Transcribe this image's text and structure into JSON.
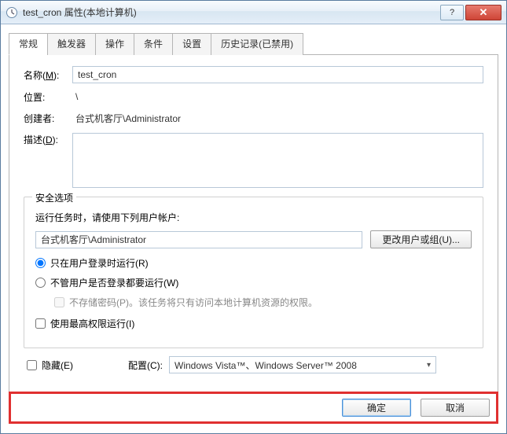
{
  "window": {
    "title": "test_cron 属性(本地计算机)",
    "close_glyph": "✕",
    "help_glyph": "?"
  },
  "tabs": {
    "general": "常规",
    "triggers": "触发器",
    "actions": "操作",
    "conditions": "条件",
    "settings": "设置",
    "history": "历史记录(已禁用)"
  },
  "general": {
    "name_label": "名称(",
    "name_key": "M",
    "name_label_end": "):",
    "name_value": "test_cron",
    "location_label": "位置:",
    "location_value": "\\",
    "creator_label": "创建者:",
    "creator_value": "台式机客厅\\Administrator",
    "desc_label": "描述(",
    "desc_key": "D",
    "desc_label_end": "):",
    "desc_value": ""
  },
  "security": {
    "legend": "安全选项",
    "run_as_label": "运行任务时，请使用下列用户帐户:",
    "account_value": "台式机客厅\\Administrator",
    "change_user_btn": "更改用户或组(U)...",
    "radio_logged_on": "只在用户登录时运行(R)",
    "radio_always": "不管用户是否登录都要运行(W)",
    "chk_nostore_pwd": "不存储密码(P)。该任务将只有访问本地计算机资源的权限。",
    "chk_highest": "使用最高权限运行(I)"
  },
  "footer": {
    "hidden_label": "隐藏(E)",
    "config_label": "配置(C):",
    "config_value": "Windows Vista™、Windows Server™ 2008",
    "ok": "确定",
    "cancel": "取消"
  }
}
